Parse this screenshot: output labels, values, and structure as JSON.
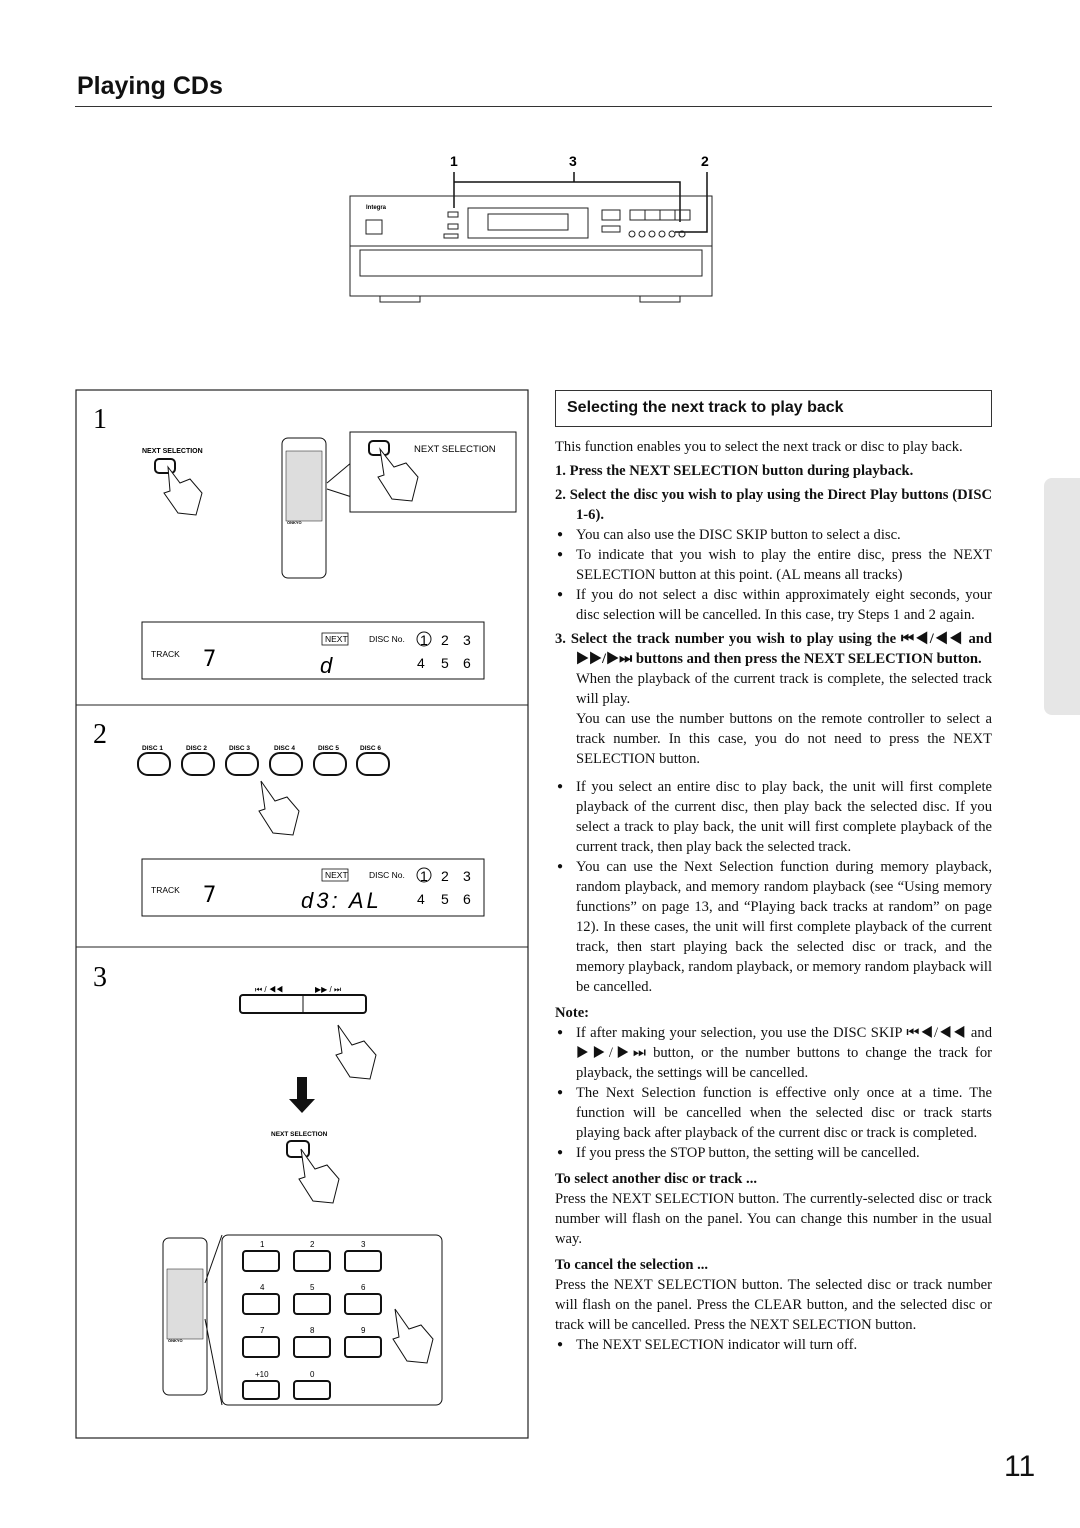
{
  "page_title": "Playing CDs",
  "page_number": "11",
  "device_callouts": [
    "1",
    "3",
    "2"
  ],
  "device_brand": "Integra",
  "panel": {
    "step1": {
      "number": "1",
      "button_label": "NEXT SELECTION",
      "callout_label": "NEXT SELECTION",
      "remote_brand": "ONKYO",
      "display": {
        "track_label": "TRACK",
        "track_value": "7",
        "next": "NEXT",
        "disc_no": "DISC No.",
        "row1": [
          "1",
          "2",
          "3"
        ],
        "row2": [
          "4",
          "5",
          "6"
        ],
        "segment": "d"
      }
    },
    "step2": {
      "number": "2",
      "discs": [
        "DISC 1",
        "DISC 2",
        "DISC 3",
        "DISC 4",
        "DISC 5",
        "DISC 6"
      ],
      "display": {
        "track_label": "TRACK",
        "track_value": "7",
        "next": "NEXT",
        "disc_no": "DISC No.",
        "row1": [
          "1",
          "2",
          "3"
        ],
        "row2": [
          "4",
          "5",
          "6"
        ],
        "segment": "d3: AL"
      }
    },
    "step3": {
      "number": "3",
      "skip_back": "⏮ / ◀◀",
      "skip_fwd": "▶▶ / ⏭",
      "button_label": "NEXT SELECTION",
      "remote_brand": "ONKYO",
      "keys": [
        "1",
        "2",
        "3",
        "4",
        "5",
        "6",
        "7",
        "8",
        "9",
        "+10",
        "0"
      ]
    }
  },
  "section": {
    "heading": "Selecting the next track to play back",
    "intro": "This function enables you to select the next track or disc to play back.",
    "step1": "1. Press the NEXT SELECTION button during playback.",
    "step2": "2. Select the disc you wish to play using the Direct Play buttons (DISC 1-6).",
    "step2_bullets": [
      "You can also use the DISC SKIP button to select a disc.",
      "To indicate that you wish to play the entire disc, press the NEXT SELECTION button at this point. (AL means all tracks)",
      "If you do not select a disc within approximately eight seconds, your disc selection will be cancelled. In this case, try Steps 1 and 2 again."
    ],
    "step3": "3. Select the track number you wish to play using the ⏮◀/◀◀ and ▶▶/▶⏭ buttons and then press the NEXT SELECTION button.",
    "step3_text1": "When the playback of the current track is complete, the selected track will play.",
    "step3_text2": "You can use the number buttons on the remote controller to select a track number. In this case, you do not need to press the NEXT SELECTION button.",
    "bullets": [
      "If you select an entire disc to play back, the unit will first complete playback of the current disc, then play back the selected disc. If you select a track to play back, the unit will first complete playback of the current track, then play back the selected track.",
      "You can use the Next Selection function during memory playback, random playback, and memory random playback (see “Using memory functions” on page 13, and “Playing back tracks at random” on page 12). In these cases, the unit will first complete playback of the current track, then start playing back the selected disc or track, and the memory playback, random playback, or memory random playback will be cancelled."
    ],
    "note_label": "Note:",
    "notes": [
      "If after making your selection, you use the DISC SKIP ⏮◀/◀◀ and ▶▶/▶⏭ button, or the number buttons to change the track for playback, the settings will be cancelled.",
      "The Next Selection function is effective only once at a time. The function will be cancelled when the selected disc or track starts playing back after playback of the current disc or track is completed.",
      "If you press the STOP button, the setting will be cancelled."
    ],
    "another_heading": "To select another disc or track ...",
    "another_text": "Press the NEXT SELECTION button. The currently-selected disc or track number will flash on the panel. You can change this number in the usual way.",
    "cancel_heading": "To cancel the selection ...",
    "cancel_text": "Press the NEXT SELECTION button. The selected disc or track number will flash on the panel. Press the CLEAR button, and the selected disc or track will be cancelled. Press the NEXT SELECTION button.",
    "cancel_bullet": "The NEXT SELECTION indicator will turn off."
  }
}
